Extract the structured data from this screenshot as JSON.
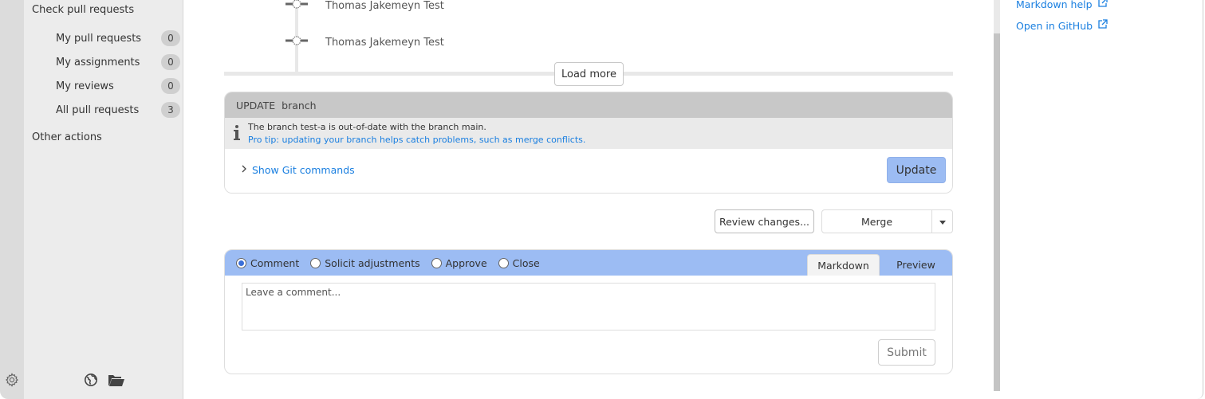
{
  "sidebar": {
    "check_heading": "Check pull requests",
    "items": [
      {
        "label": "My pull requests",
        "count": "0"
      },
      {
        "label": "My assignments",
        "count": "0"
      },
      {
        "label": "My reviews",
        "count": "0"
      },
      {
        "label": "All pull requests",
        "count": "3"
      }
    ],
    "other_heading": "Other actions",
    "footer_icons": [
      "settings-icon",
      "globe-icon",
      "folder-icon"
    ]
  },
  "timeline": {
    "commits": [
      {
        "label": "Thomas Jakemeyn Test",
        "icon": "commit-icon"
      },
      {
        "label": "Thomas Jakemeyn Test",
        "icon": "commit-icon"
      }
    ],
    "load_more_label": "Load more"
  },
  "update_branch": {
    "title": "UPDATE  branch",
    "message": "The branch test-a is out-of-date with the branch main.",
    "tip": "Pro tip: updating your branch helps catch problems, such as merge conflicts.",
    "show_git_commands": "Show Git commands",
    "update_label": "Update"
  },
  "actions": {
    "review_label": "Review changes...",
    "merge_label": "Merge"
  },
  "comment": {
    "options": [
      {
        "label": "Comment",
        "selected": true
      },
      {
        "label": "Solicit adjustments",
        "selected": false
      },
      {
        "label": "Approve",
        "selected": false
      },
      {
        "label": "Close",
        "selected": false
      }
    ],
    "tabs": [
      {
        "label": "Markdown",
        "active": true
      },
      {
        "label": "Preview",
        "active": false
      }
    ],
    "placeholder": "Leave a comment...",
    "value": "",
    "submit_label": "Submit"
  },
  "right_panel": {
    "links": [
      {
        "label": "Markdown help",
        "icon": "external-link-icon"
      },
      {
        "label": "Open in GitHub",
        "icon": "external-link-icon"
      }
    ]
  },
  "colors": {
    "accent_blue": "#9cbcf3",
    "link_blue": "#1a7fe0",
    "header_gray": "#c8c8c8",
    "sidebar_bg": "#ececec"
  }
}
